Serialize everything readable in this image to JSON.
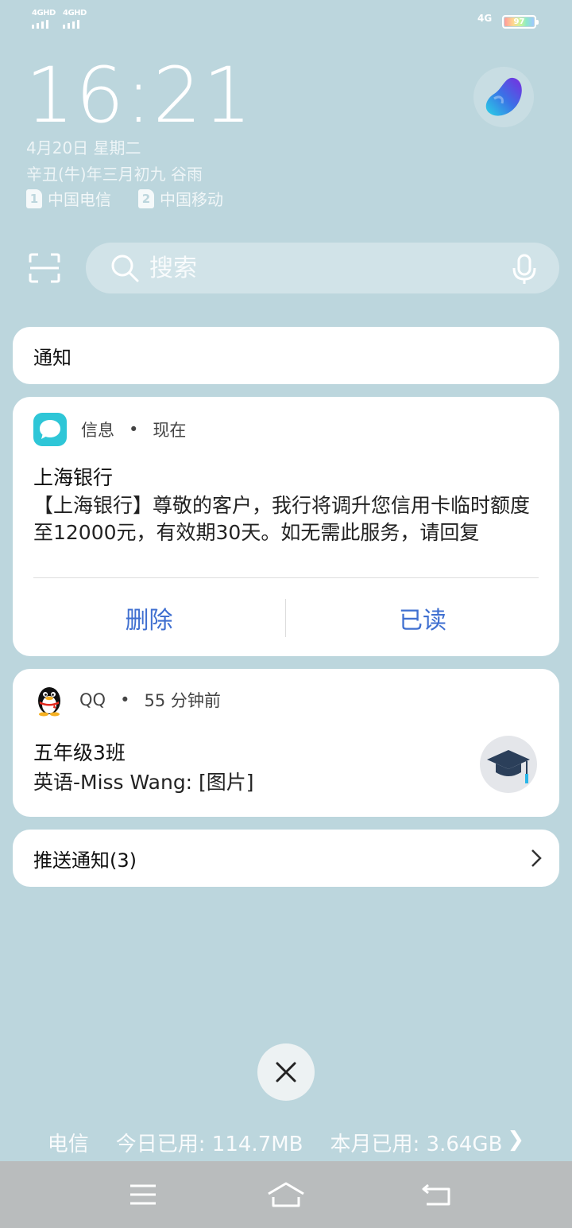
{
  "status": {
    "sim1_network": "4GHD",
    "sim2_network": "4GHD",
    "data_network": "4G",
    "battery_level": "97"
  },
  "lockscreen": {
    "time": "16:21",
    "date": "4月20日 星期二",
    "lunar_date": "辛丑(牛)年三月初九 谷雨",
    "carriers": [
      {
        "slot": "1",
        "name": "中国电信"
      },
      {
        "slot": "2",
        "name": "中国移动"
      }
    ]
  },
  "search": {
    "placeholder": "搜索"
  },
  "notifications": {
    "header": "通知",
    "message": {
      "app": "信息",
      "time": "现在",
      "title": "上海银行",
      "body": "【上海银行】尊敬的客户，我行将调升您信用卡临时额度至12000元，有效期30天。如无需此服务，请回复",
      "actions": {
        "delete": "删除",
        "mark_read": "已读"
      }
    },
    "qq": {
      "app": "QQ",
      "time": "55 分钟前",
      "title": "五年级3班",
      "body": "英语-Miss Wang: [图片]"
    },
    "push": {
      "label": "推送通知(3)"
    }
  },
  "usage": {
    "carrier": "电信",
    "today": "今日已用: 114.7MB",
    "month": "本月已用: 3.64GB",
    "arrow": "❯"
  },
  "colors": {
    "background": "#bcd6dd",
    "action_blue": "#3f6fd0",
    "message_app": "#2ec6d7",
    "nav_bar": "#b9bcbd"
  }
}
